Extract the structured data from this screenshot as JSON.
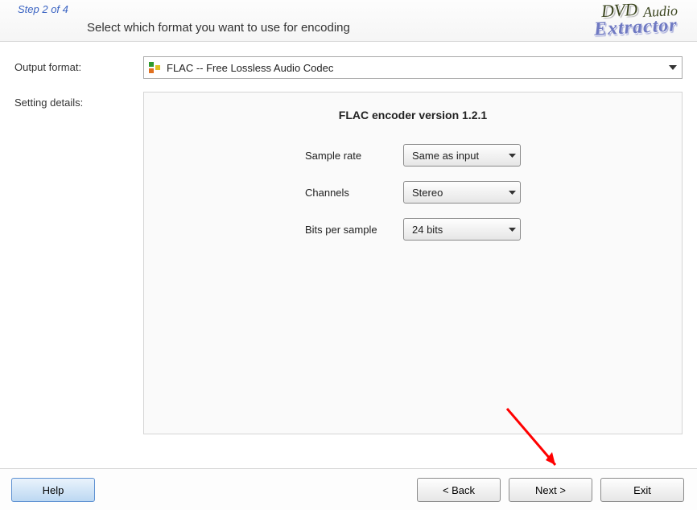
{
  "header": {
    "step_text": "Step 2 of 4",
    "title": "Select which format you want to use for encoding",
    "logo": {
      "line1a": "DVD",
      "line1b": "Audio",
      "line2": "Extractor"
    }
  },
  "labels": {
    "output_format": "Output format:",
    "setting_details": "Setting details:"
  },
  "output_format": {
    "selected": "FLAC -- Free Lossless Audio Codec"
  },
  "settings": {
    "title": "FLAC encoder version 1.2.1",
    "rows": [
      {
        "label": "Sample rate",
        "value": "Same as input"
      },
      {
        "label": "Channels",
        "value": "Stereo"
      },
      {
        "label": "Bits per sample",
        "value": "24 bits"
      }
    ]
  },
  "footer": {
    "help": "Help",
    "back": "< Back",
    "next": "Next >",
    "exit": "Exit"
  }
}
